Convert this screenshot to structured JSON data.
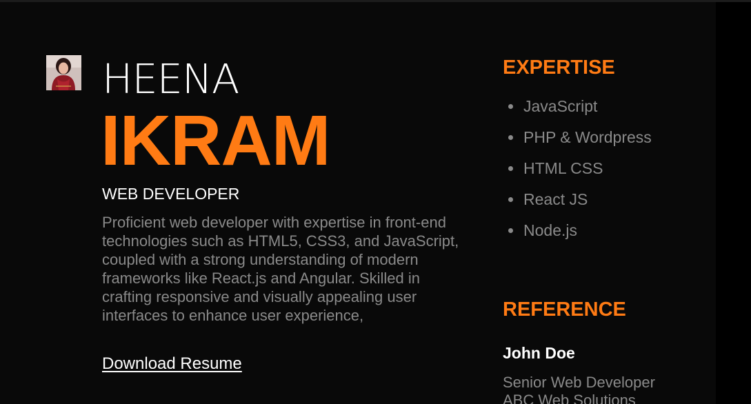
{
  "profile": {
    "first_name": "HEENA",
    "last_name": "IKRAM",
    "role": "WEB DEVELOPER",
    "bio": "Proficient web developer with expertise in front-end technologies such as HTML5, CSS3, and JavaScript, coupled with a strong understanding of modern frameworks like React.js and Angular. Skilled in crafting responsive and visually appealing user interfaces to enhance user experience,",
    "download_label": "Download Resume"
  },
  "expertise": {
    "title": "EXPERTISE",
    "items": [
      "JavaScript",
      "PHP & Wordpress",
      "HTML CSS",
      "React JS",
      "Node.js"
    ]
  },
  "reference": {
    "title": "REFERENCE",
    "name": "John Doe",
    "job_title": "Senior Web Developer",
    "company": "ABC Web Solutions"
  },
  "colors": {
    "accent": "#ff7b14",
    "background": "#090909",
    "muted_text": "#8a8a8a",
    "text": "#ffffff"
  }
}
